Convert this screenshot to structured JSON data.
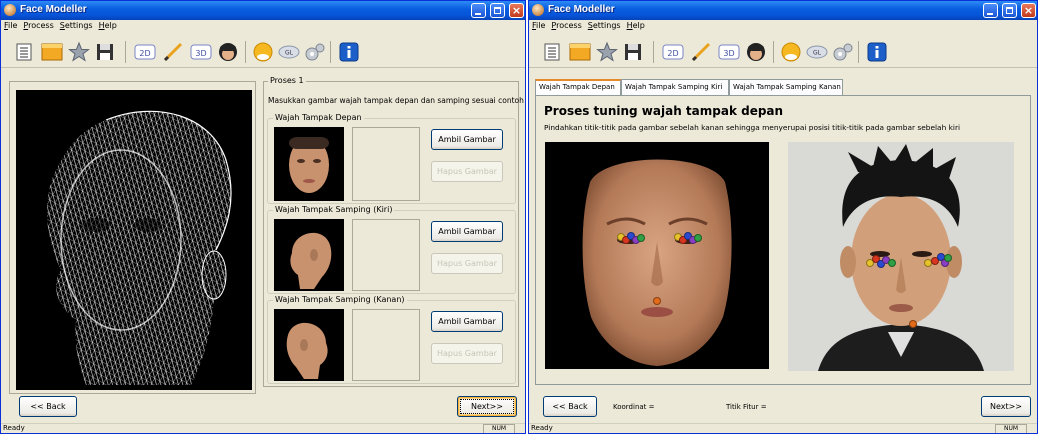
{
  "app": {
    "title": "Face Modeller"
  },
  "menu": [
    "File",
    "Process",
    "Settings",
    "Help"
  ],
  "toolbar_icons": [
    "list-icon",
    "panel-icon",
    "star-icon",
    "save-icon",
    "2d-icon",
    "pencil-icon",
    "3d-icon",
    "head-icon",
    "face-icon",
    "opengl-icon",
    "gears-icon",
    "info-icon"
  ],
  "toolbar_text": {
    "twoD": "2D",
    "threeD": "3D",
    "gl": "GL"
  },
  "left": {
    "proses_label": "Proses 1",
    "instruction": "Masukkan gambar wajah tampak depan dan samping sesuai contoh :",
    "groups": [
      {
        "label": "Wajah Tampak Depan",
        "take": "Ambil Gambar",
        "remove": "Hapus Gambar"
      },
      {
        "label": "Wajah Tampak Samping (Kiri)",
        "take": "Ambil Gambar",
        "remove": "Hapus Gambar"
      },
      {
        "label": "Wajah Tampak Samping (Kanan)",
        "take": "Ambil Gambar",
        "remove": "Hapus Gambar"
      }
    ],
    "back": "<< Back",
    "next": "Next>>",
    "status": "Ready",
    "num": "NUM"
  },
  "right": {
    "tabs": [
      "Wajah Tampak Depan",
      "Wajah Tampak Samping Kiri",
      "Wajah Tampak Samping Kanan"
    ],
    "heading": "Proses tuning wajah tampak depan",
    "instruction": "Pindahkan titik-titik pada gambar sebelah kanan sehingga menyerupai posisi titik-titik pada gambar sebelah kiri",
    "back": "<< Back",
    "koordinat": "Koordinat =",
    "titik": "Titik Fitur =",
    "next": "Next>>",
    "status": "Ready",
    "num": "NUM"
  },
  "colors": {
    "title_blue": "#0654d9",
    "close_red": "#c1391b",
    "focus_orange": "#f8b33c",
    "skin": "#c9926e"
  }
}
